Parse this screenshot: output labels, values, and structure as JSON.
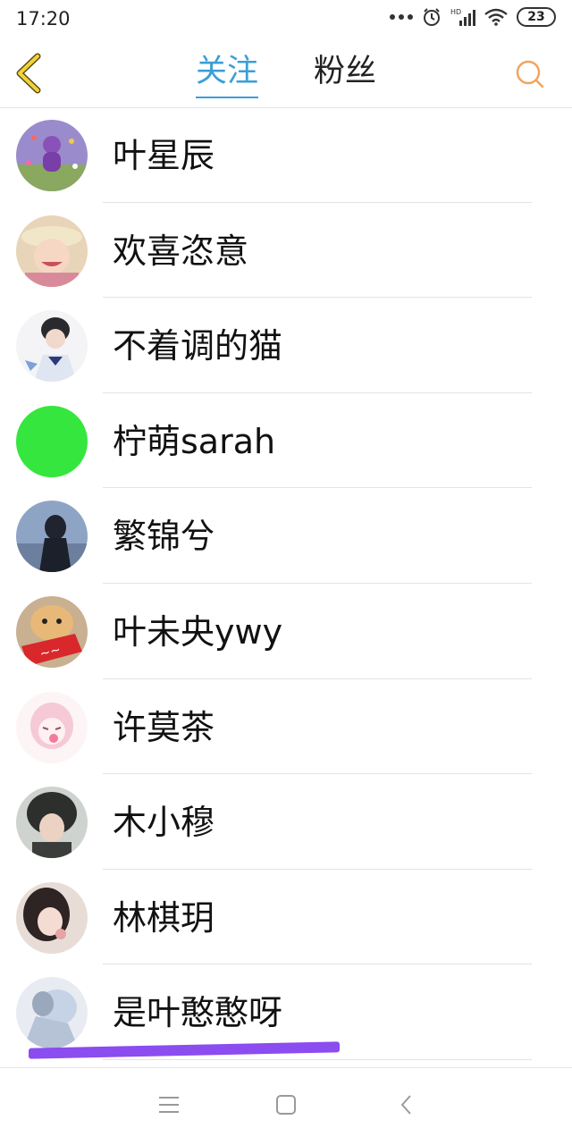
{
  "status_bar": {
    "time": "17:20",
    "battery": "23",
    "network": "HD"
  },
  "header": {
    "tabs": [
      {
        "label": "关注",
        "active": true
      },
      {
        "label": "粉丝",
        "active": false
      }
    ],
    "accent_color": "#3a9fd8",
    "back_icon": "chevron-left-icon",
    "search_icon": "search-icon"
  },
  "contacts": [
    {
      "name": "叶星辰"
    },
    {
      "name": "欢喜恣意"
    },
    {
      "name": "不着调的猫"
    },
    {
      "name": "柠萌sarah"
    },
    {
      "name": "繁锦兮"
    },
    {
      "name": "叶未央ywy"
    },
    {
      "name": "许莫茶"
    },
    {
      "name": "木小穆"
    },
    {
      "name": "林棋玥"
    },
    {
      "name": "是叶憨憨呀"
    }
  ],
  "nav_bar": {
    "icons": [
      "menu-icon",
      "home-square-icon",
      "back-triangle-icon"
    ]
  }
}
